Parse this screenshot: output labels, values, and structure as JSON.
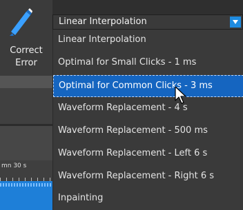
{
  "tool": {
    "label_line1": "Correct",
    "label_line2": "Error",
    "icon": "pencil-icon"
  },
  "timeline": {
    "label": "mn 30 s"
  },
  "combo": {
    "value": "Linear Interpolation",
    "arrow_icon": "chevron-down-icon"
  },
  "dropdown": {
    "options": [
      {
        "label": "Linear Interpolation"
      },
      {
        "label": "Optimal for Small Clicks - 1 ms"
      },
      {
        "label": "Optimal for Common Clicks - 3 ms"
      },
      {
        "label": "Waveform Replacement - 4 s"
      },
      {
        "label": "Waveform Replacement - 500 ms"
      },
      {
        "label": "Waveform Replacement - Left 6 s"
      },
      {
        "label": "Waveform Replacement - Right 6 s"
      },
      {
        "label": "Inpainting"
      }
    ],
    "highlighted": "Optimal for Common Clicks - 3 ms"
  },
  "colors": {
    "accent": "#1e8be0",
    "highlight": "#1565c0",
    "waveform": "#1e7fd8",
    "panel": "#3a3a3a"
  }
}
